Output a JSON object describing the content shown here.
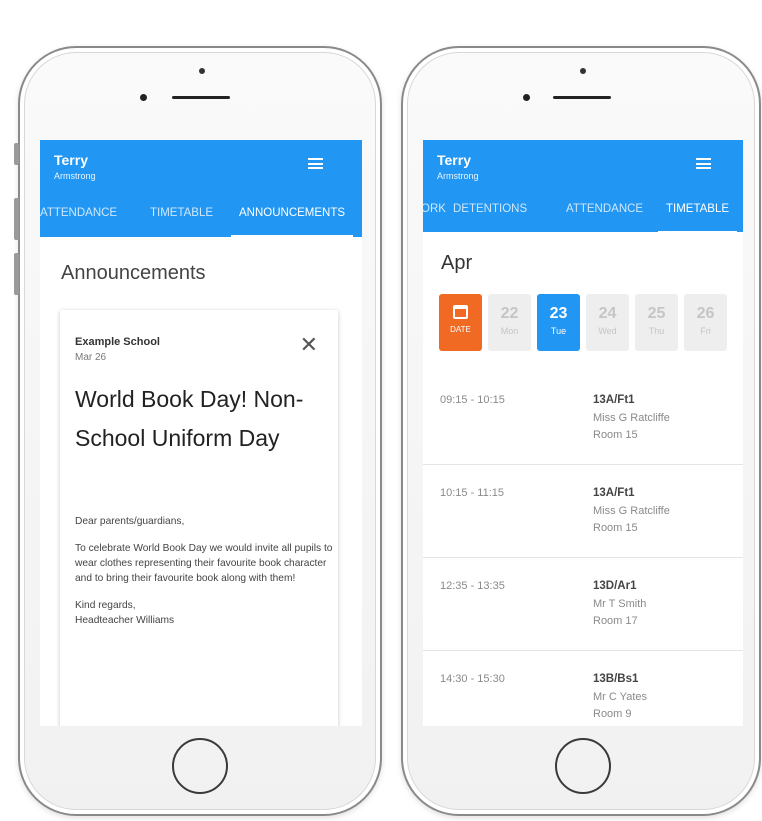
{
  "left_phone": {
    "user": {
      "first_name": "Terry",
      "last_name": "Armstrong"
    },
    "tabs": [
      "ATTENDANCE",
      "TIMETABLE",
      "ANNOUNCEMENTS"
    ],
    "active_tab": "ANNOUNCEMENTS",
    "heading": "Announcements",
    "announcement": {
      "school": "Example School",
      "date": "Mar 26",
      "close_glyph": "✕",
      "title": "World Book Day! Non-School Uniform Day",
      "greeting": "Dear parents/guardians,",
      "body": "To celebrate World Book Day we would invite all pupils to wear clothes representing their favourite book character and to bring their favourite book along with them!",
      "signoff": "Kind regards,",
      "signature": "Headteacher Williams"
    }
  },
  "right_phone": {
    "user": {
      "first_name": "Terry",
      "last_name": "Armstrong"
    },
    "tabs": [
      "ORK",
      "DETENTIONS",
      "ATTENDANCE",
      "TIMETABLE"
    ],
    "active_tab": "TIMETABLE",
    "month": "Apr",
    "date_picker_label": "DATE",
    "days": [
      {
        "num": "22",
        "name": "Mon"
      },
      {
        "num": "23",
        "name": "Tue",
        "today": true
      },
      {
        "num": "24",
        "name": "Wed"
      },
      {
        "num": "25",
        "name": "Thu"
      },
      {
        "num": "26",
        "name": "Fri"
      }
    ],
    "lessons": [
      {
        "time": "09:15 - 10:15",
        "class": "13A/Ft1",
        "teacher": "Miss G Ratcliffe",
        "room": "Room 15"
      },
      {
        "time": "10:15 - 11:15",
        "class": "13A/Ft1",
        "teacher": "Miss G Ratcliffe",
        "room": "Room 15"
      },
      {
        "time": "12:35 - 13:35",
        "class": "13D/Ar1",
        "teacher": "Mr T Smith",
        "room": "Room 17"
      },
      {
        "time": "14:30 - 15:30",
        "class": "13B/Bs1",
        "teacher": "Mr C Yates",
        "room": "Room 9"
      }
    ]
  },
  "colors": {
    "app_bar": "#2196f3",
    "date_picker": "#f16a24",
    "today": "#2196f3"
  },
  "icons": {
    "menu": "hamburger-icon",
    "close": "close-icon",
    "calendar": "calendar-icon"
  }
}
